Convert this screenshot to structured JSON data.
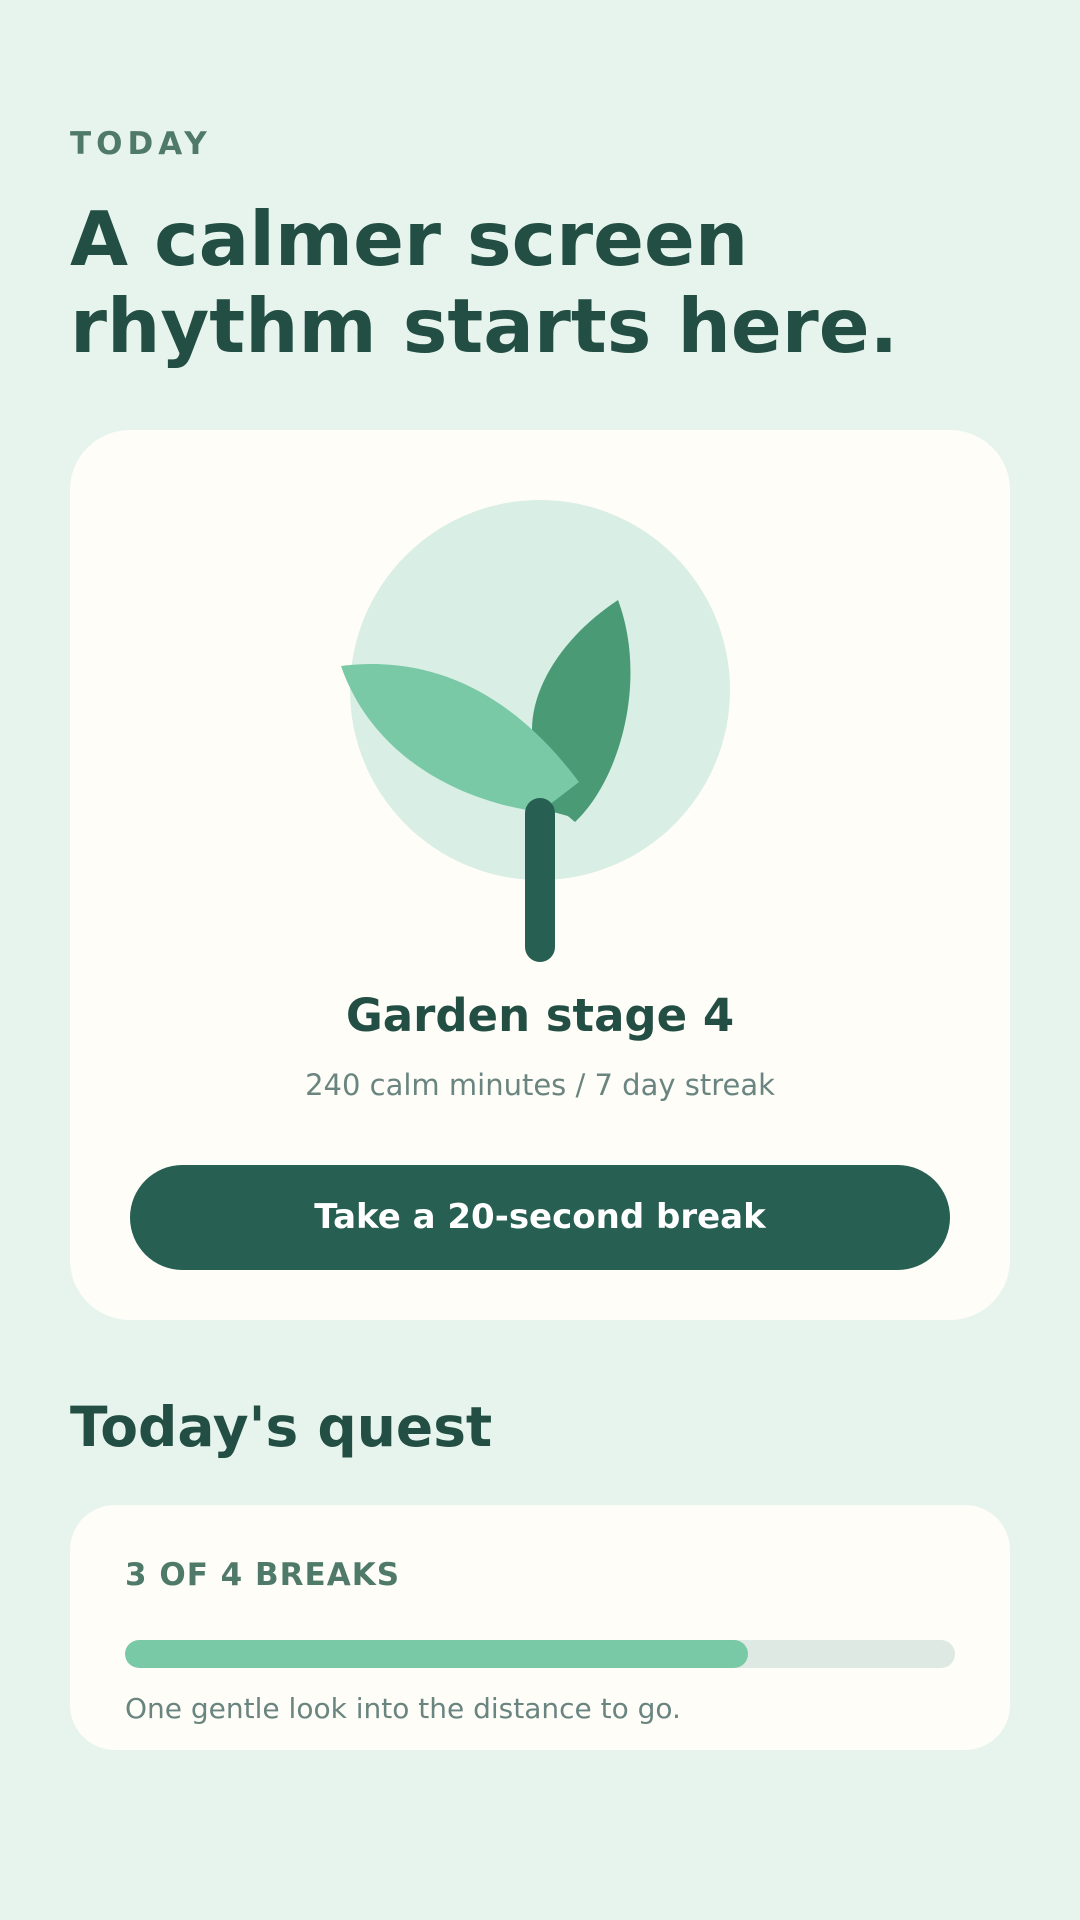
{
  "header": {
    "eyebrow": "TODAY",
    "headline": "A calmer screen rhythm starts here."
  },
  "garden": {
    "illustration_icon": "sprout-icon",
    "stage_title": "Garden stage 4",
    "stats": "240 calm minutes / 7 day streak",
    "break_button_label": "Take a 20-second break",
    "colors": {
      "circle": "#d9eee4",
      "leaf_light": "#79c9a6",
      "leaf_dark": "#4a9a76",
      "stem": "#275f52"
    }
  },
  "quest": {
    "heading": "Today's quest",
    "count_label": "3 OF 4 BREAKS",
    "progress": 0.75,
    "hint": "One gentle look into the distance to go."
  },
  "colors": {
    "background": "#e7f4ee",
    "card": "#fefdf8",
    "accent_dark": "#275f52",
    "text_dark": "#234e43",
    "progress_fill": "#79c9a6",
    "progress_track": "#dde9e2"
  }
}
